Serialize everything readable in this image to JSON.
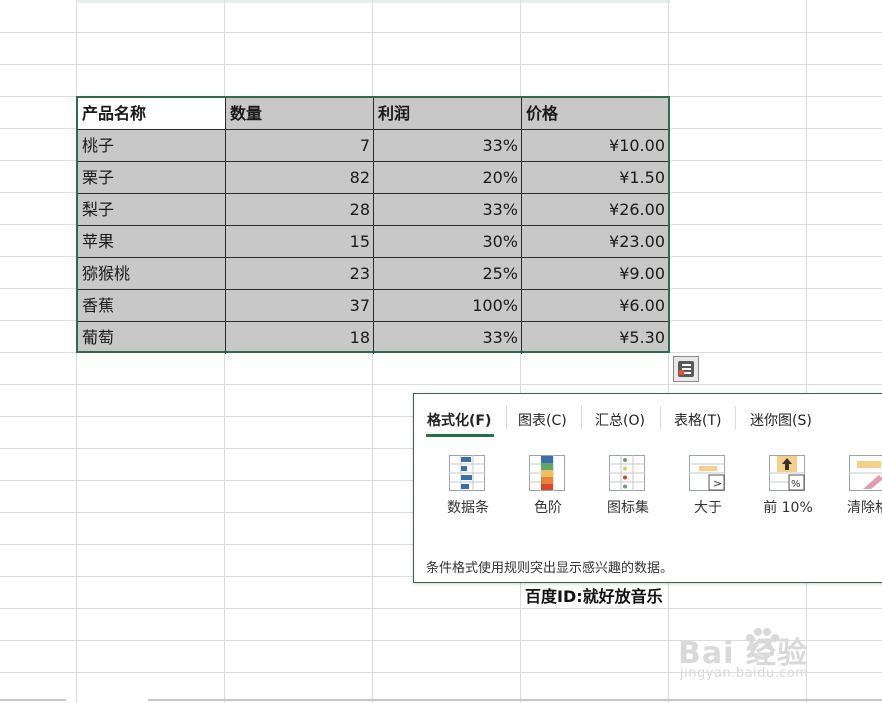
{
  "table": {
    "headers": [
      "产品名称",
      "数量",
      "利润",
      "价格"
    ],
    "rows": [
      [
        "桃子",
        "7",
        "33%",
        "¥10.00"
      ],
      [
        "栗子",
        "82",
        "20%",
        "¥1.50"
      ],
      [
        "梨子",
        "28",
        "33%",
        "¥26.00"
      ],
      [
        "苹果",
        "15",
        "30%",
        "¥23.00"
      ],
      [
        "猕猴桃",
        "23",
        "25%",
        "¥9.00"
      ],
      [
        "香蕉",
        "37",
        "100%",
        "¥6.00"
      ],
      [
        "葡萄",
        "18",
        "33%",
        "¥5.30"
      ]
    ]
  },
  "quick_analysis": {
    "button_icon": "quick-analysis-icon",
    "tabs": [
      {
        "label": "格式化(F)",
        "active": true
      },
      {
        "label": "图表(C)",
        "active": false
      },
      {
        "label": "汇总(O)",
        "active": false
      },
      {
        "label": "表格(T)",
        "active": false
      },
      {
        "label": "迷你图(S)",
        "active": false
      }
    ],
    "items": [
      {
        "label": "数据条",
        "icon": "data-bars-icon"
      },
      {
        "label": "色阶",
        "icon": "color-scale-icon"
      },
      {
        "label": "图标集",
        "icon": "icon-set-icon"
      },
      {
        "label": "大于",
        "icon": "greater-than-icon"
      },
      {
        "label": "前 10%",
        "icon": "top-10-percent-icon"
      },
      {
        "label": "清除格",
        "icon": "clear-format-icon"
      }
    ],
    "description": "条件格式使用规则突出显示感兴趣的数据。"
  },
  "watermark": {
    "text": "百度ID:就好放音乐",
    "logo": "Bai 经验",
    "logo_sub": "jingyan.baidu.com"
  },
  "colors": {
    "selection_border": "#2f6b47",
    "selection_fill": "#c8c8c8",
    "active_tab_underline": "#217346"
  }
}
